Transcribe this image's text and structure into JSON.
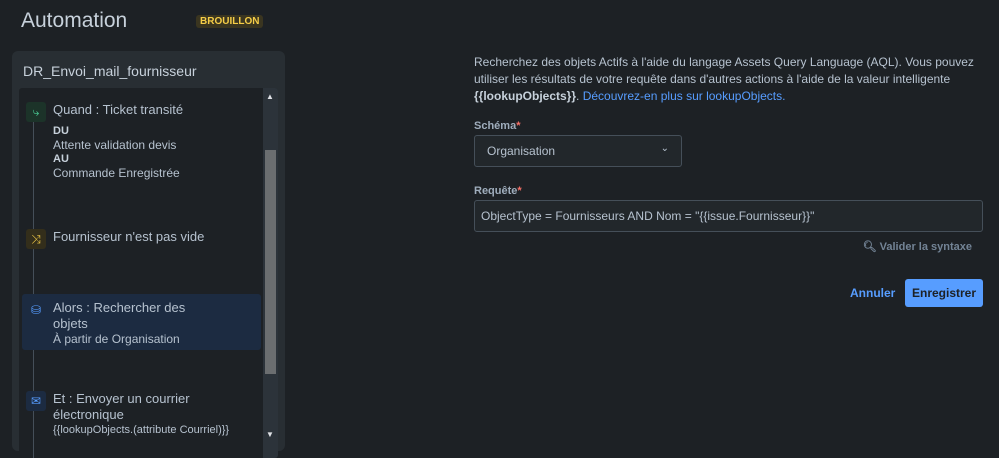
{
  "header": {
    "title": "Automation",
    "status_badge": "BROUILLON"
  },
  "rule": {
    "name": "DR_Envoi_mail_fournisseur",
    "steps": [
      {
        "title": "Quand : Ticket transité",
        "from_label": "DU",
        "from": "Attente validation devis",
        "to_label": "AU",
        "to": "Commande Enregistrée",
        "icon": "transition-icon"
      },
      {
        "title": "Fournisseur n'est pas vide",
        "icon": "condition-shuffle-icon"
      },
      {
        "title": "Alors : Rechercher des objets",
        "subtitle": "À partir de Organisation",
        "icon": "database-icon"
      },
      {
        "title": "Et : Envoyer un courrier électronique",
        "subtitle": "{{lookupObjects.(attribute Courriel)}}",
        "icon": "mail-icon"
      }
    ]
  },
  "form": {
    "desc_part1": "Recherchez des objets Actifs à l'aide du langage Assets Query Language (AQL). Vous pouvez utiliser les résultats de votre requête dans d'autres actions à l'aide de la valeur intelligente ",
    "desc_smart": "{{lookupObjects}}",
    "desc_part2": ". ",
    "desc_link": "Découvrez-en plus sur lookupObjects.",
    "schema_label": "Schéma",
    "schema_value": "Organisation",
    "query_label": "Requête",
    "query_value": "ObjectType = Fournisseurs AND Nom = \"{{issue.Fournisseur}}\"",
    "required_mark": "*",
    "validate_label": "Valider la syntaxe",
    "cancel_label": "Annuler",
    "save_label": "Enregistrer"
  }
}
